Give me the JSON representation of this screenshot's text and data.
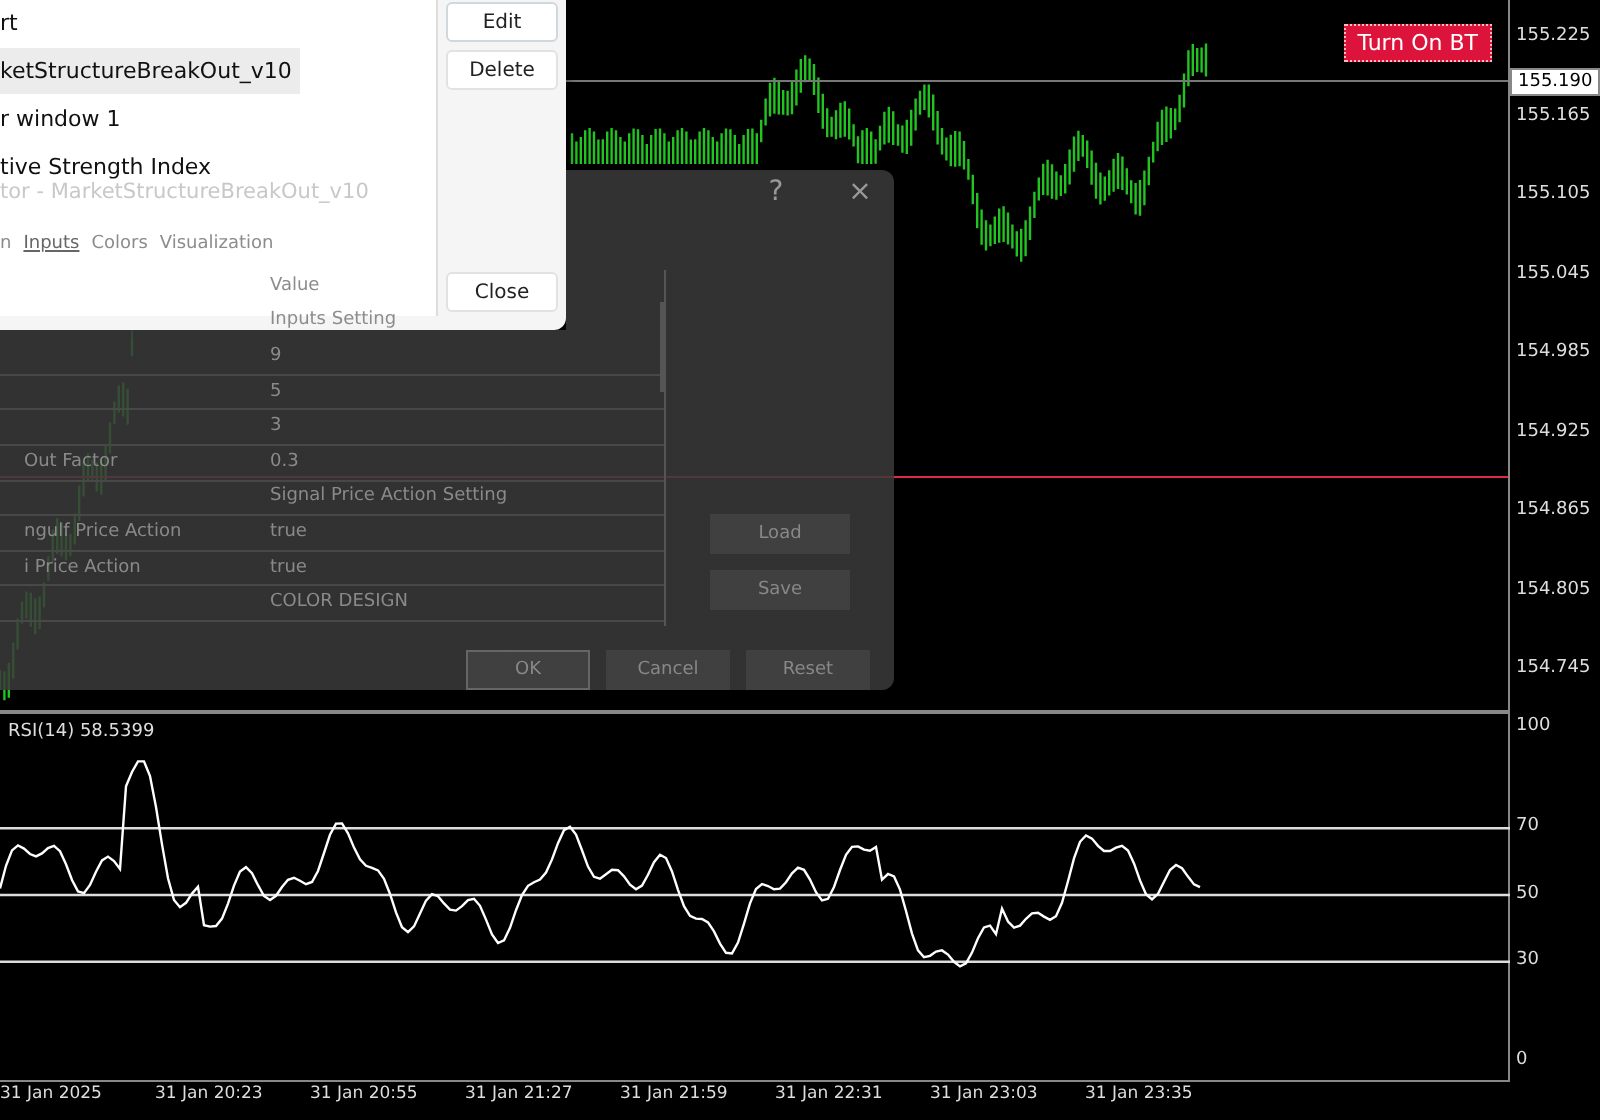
{
  "indicator_list": {
    "items": [
      {
        "label": "rt",
        "selected": false
      },
      {
        "label": "ketStructureBreakOut_v10",
        "selected": true
      },
      {
        "label": "r window 1",
        "selected": false
      },
      {
        "label": "tive Strength Index",
        "selected": false
      }
    ],
    "buttons": [
      {
        "label": "Edit",
        "kind": "top"
      },
      {
        "label": "Delete",
        "kind": "top"
      },
      {
        "label": "Close",
        "kind": "bottom"
      }
    ]
  },
  "properties_dialog": {
    "title": "tor - MarketStructureBreakOut_v10",
    "help": "?",
    "close": "×",
    "tabs": [
      {
        "label": "n",
        "selected": false
      },
      {
        "label": "Inputs",
        "selected": true
      },
      {
        "label": "Colors",
        "selected": false
      },
      {
        "label": "Visualization",
        "selected": false
      }
    ],
    "value_header": "Value",
    "rows": [
      {
        "name": "",
        "value": "Inputs Setting"
      },
      {
        "name": "",
        "value": "9"
      },
      {
        "name": "",
        "value": "5"
      },
      {
        "name": "",
        "value": "3"
      },
      {
        "name": "Out Factor",
        "value": "0.3"
      },
      {
        "name": "",
        "value": "Signal Price Action Setting"
      },
      {
        "name": "ngulf Price Action",
        "value": "true"
      },
      {
        "name": "i Price Action",
        "value": "true"
      },
      {
        "name": "",
        "value": "COLOR DESIGN"
      }
    ],
    "side_buttons": [
      "Load",
      "Save"
    ],
    "buttons": [
      {
        "label": "OK",
        "selected": true
      },
      {
        "label": "Cancel",
        "selected": false
      },
      {
        "label": "Reset",
        "selected": false
      }
    ]
  },
  "chart": {
    "bt_button": "Turn On BT",
    "current_price": "155.190",
    "price_axis": [
      "155.225",
      "155.165",
      "155.105",
      "155.045",
      "154.985",
      "154.925",
      "154.865",
      "154.805",
      "154.745"
    ],
    "indicator_label": "RSI(14) 58.5399",
    "rsi_axis": [
      "100",
      "70",
      "50",
      "30",
      "0"
    ],
    "time_axis": [
      "31 Jan 2025",
      "31 Jan 20:23",
      "31 Jan 20:55",
      "31 Jan 21:27",
      "31 Jan 21:59",
      "31 Jan 22:31",
      "31 Jan 23:03",
      "31 Jan 23:35"
    ]
  }
}
